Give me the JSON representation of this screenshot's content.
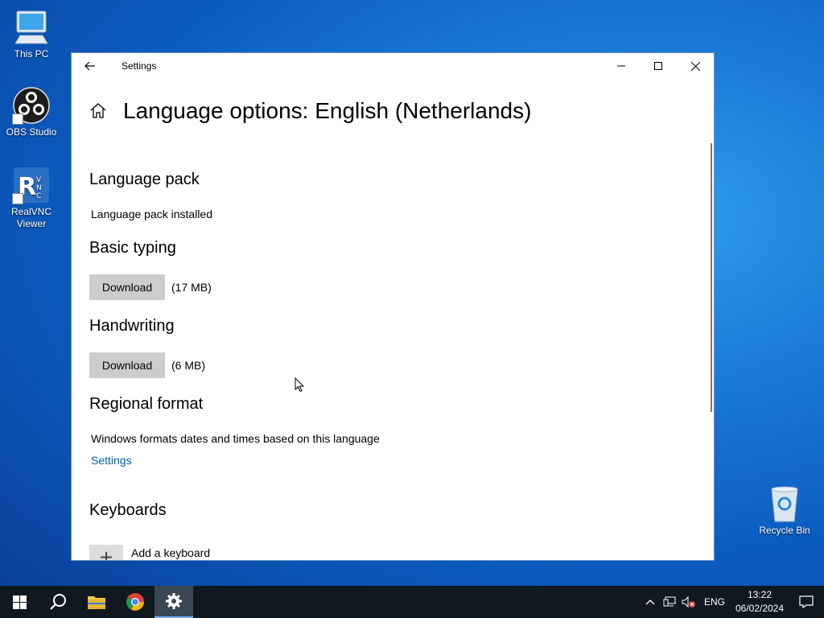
{
  "desktop": {
    "icons": [
      {
        "label": "This PC"
      },
      {
        "label": "OBS Studio"
      },
      {
        "label": "RealVNC Viewer"
      },
      {
        "label": "Recycle Bin"
      }
    ]
  },
  "window": {
    "title": "Settings",
    "page_title": "Language options: English (Netherlands)",
    "sections": {
      "language_pack": {
        "heading": "Language pack",
        "status": "Language pack installed"
      },
      "basic_typing": {
        "heading": "Basic typing",
        "button": "Download",
        "size": "(17 MB)"
      },
      "handwriting": {
        "heading": "Handwriting",
        "button": "Download",
        "size": "(6 MB)"
      },
      "regional_format": {
        "heading": "Regional format",
        "description": "Windows formats dates and times based on this language",
        "link": "Settings"
      },
      "keyboards": {
        "heading": "Keyboards",
        "add_label": "Add a keyboard"
      }
    }
  },
  "taskbar": {
    "language": "ENG",
    "time": "13:22",
    "date": "06/02/2024"
  },
  "colors": {
    "accent_link": "#0063b1",
    "taskbar": "#101820",
    "button": "#cccccc"
  }
}
